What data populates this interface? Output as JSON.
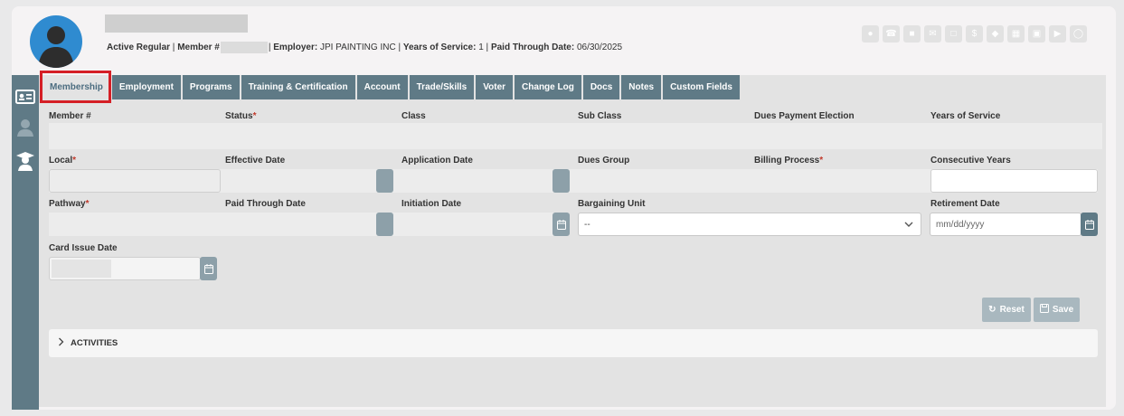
{
  "header": {
    "status_label": "Active Regular",
    "member_label": "Member #",
    "employer_label": "Employer:",
    "employer_value": "JPI PAINTING INC",
    "years_label": "Years of Service:",
    "years_value": "1",
    "paid_label": "Paid Through Date:",
    "paid_value": "06/30/2025",
    "action_icons": [
      "person-icon",
      "phone-icon",
      "chat-icon",
      "email-icon",
      "document-icon",
      "dollar-icon",
      "tag-icon",
      "id-card-icon",
      "clipboard-icon",
      "folder-icon",
      "clock-icon"
    ]
  },
  "sidenav": {
    "items": [
      "id-card-icon",
      "person-icon",
      "graduate-icon"
    ]
  },
  "tabs": [
    {
      "label": "Membership",
      "active": true
    },
    {
      "label": "Employment"
    },
    {
      "label": "Programs"
    },
    {
      "label": "Training & Certification"
    },
    {
      "label": "Account"
    },
    {
      "label": "Trade/Skills"
    },
    {
      "label": "Voter"
    },
    {
      "label": "Change Log"
    },
    {
      "label": "Docs"
    },
    {
      "label": "Notes"
    },
    {
      "label": "Custom Fields"
    }
  ],
  "fields": {
    "member_no": "Member #",
    "status": "Status",
    "class": "Class",
    "sub_class": "Sub Class",
    "dues_payment_election": "Dues Payment Election",
    "years_of_service": "Years of Service",
    "local": "Local",
    "effective_date": "Effective Date",
    "application_date": "Application Date",
    "dues_group": "Dues Group",
    "billing_process": "Billing Process",
    "consecutive_years": "Consecutive Years",
    "pathway": "Pathway",
    "paid_through_date": "Paid Through Date",
    "initiation_date": "Initiation Date",
    "bargaining_unit": "Bargaining Unit",
    "retirement_date": "Retirement Date",
    "card_issue_date": "Card Issue Date",
    "required_mark": "*"
  },
  "inputs": {
    "bargaining_unit_value": "--",
    "retirement_placeholder": "mm/dd/yyyy"
  },
  "buttons": {
    "reset": "Reset",
    "save": "Save"
  },
  "activities": {
    "label": "ACTIVITIES"
  },
  "colors": {
    "tab_bg": "#5f7a86",
    "active_tab_text": "#4c6d80",
    "highlight": "#d51f26",
    "avatar_bg": "#2f8bd0",
    "required": "#c0392b"
  }
}
